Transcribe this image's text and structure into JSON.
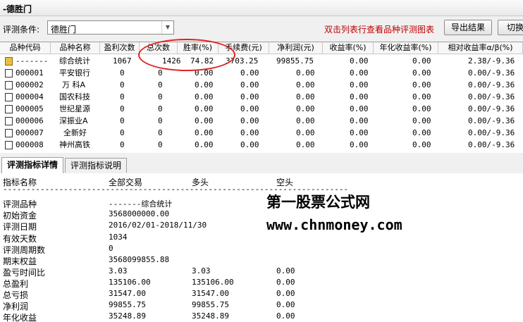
{
  "window": {
    "title": "-德胜门"
  },
  "toolbar": {
    "condition_label": "评测条件:",
    "condition_value": "德胜门",
    "hint": "双击列表行查看品种评测图表",
    "export_label": "导出结果",
    "switch_label": "切换"
  },
  "table": {
    "columns": [
      "品种代码",
      "品种名称",
      "盈利次数",
      "总次数",
      "胜率(%)",
      "手续费(元)",
      "净利润(元)",
      "收益率(%)",
      "年化收益率(%)",
      "相对收益率α/β(%)"
    ],
    "rows": [
      {
        "code": "-------",
        "name": "综合统计",
        "wins": "1067",
        "total": "1426",
        "rate": "74.82",
        "fee": "3703.25",
        "profit": "99855.75",
        "ret": "0.00",
        "annual": "0.00",
        "relative": "2.38/-9.36"
      },
      {
        "code": "000001",
        "name": "平安银行",
        "wins": "0",
        "total": "0",
        "rate": "0.00",
        "fee": "0.00",
        "profit": "0.00",
        "ret": "0.00",
        "annual": "0.00",
        "relative": "0.00/-9.36"
      },
      {
        "code": "000002",
        "name": "万 科A",
        "wins": "0",
        "total": "0",
        "rate": "0.00",
        "fee": "0.00",
        "profit": "0.00",
        "ret": "0.00",
        "annual": "0.00",
        "relative": "0.00/-9.36"
      },
      {
        "code": "000004",
        "name": "国农科技",
        "wins": "0",
        "total": "0",
        "rate": "0.00",
        "fee": "0.00",
        "profit": "0.00",
        "ret": "0.00",
        "annual": "0.00",
        "relative": "0.00/-9.36"
      },
      {
        "code": "000005",
        "name": "世纪星源",
        "wins": "0",
        "total": "0",
        "rate": "0.00",
        "fee": "0.00",
        "profit": "0.00",
        "ret": "0.00",
        "annual": "0.00",
        "relative": "0.00/-9.36"
      },
      {
        "code": "000006",
        "name": "深振业A",
        "wins": "0",
        "total": "0",
        "rate": "0.00",
        "fee": "0.00",
        "profit": "0.00",
        "ret": "0.00",
        "annual": "0.00",
        "relative": "0.00/-9.36"
      },
      {
        "code": "000007",
        "name": "全新好",
        "wins": "0",
        "total": "0",
        "rate": "0.00",
        "fee": "0.00",
        "profit": "0.00",
        "ret": "0.00",
        "annual": "0.00",
        "relative": "0.00/-9.36"
      },
      {
        "code": "000008",
        "name": "神州高铁",
        "wins": "0",
        "total": "0",
        "rate": "0.00",
        "fee": "0.00",
        "profit": "0.00",
        "ret": "0.00",
        "annual": "0.00",
        "relative": "0.00/-9.36"
      }
    ]
  },
  "tabs": [
    {
      "label": "评测指标详情"
    },
    {
      "label": "评测指标说明"
    }
  ],
  "detail": {
    "headers": {
      "name": "指标名称",
      "all": "全部交易",
      "long": "多头",
      "short": "空头"
    },
    "divider": "--------------------------------------------------------------------------",
    "rows": [
      {
        "name": "评测品种",
        "all": "-------综合统计",
        "long": "",
        "short": ""
      },
      {
        "name": "初始资金",
        "all": "3568000000.00",
        "long": "",
        "short": ""
      },
      {
        "name": "评测日期",
        "all": "2016/02/01-2018/11/30",
        "long": "",
        "short": ""
      },
      {
        "name": "有效天数",
        "all": "1034",
        "long": "",
        "short": ""
      },
      {
        "name": "评测周期数",
        "all": "0",
        "long": "",
        "short": ""
      },
      {
        "name": "期末权益",
        "all": "3568099855.88",
        "long": "",
        "short": ""
      },
      {
        "name": "盈亏时间比",
        "all": "3.03",
        "long": "3.03",
        "short": "0.00"
      },
      {
        "name": "总盈利",
        "all": "135106.00",
        "long": "135106.00",
        "short": "0.00"
      },
      {
        "name": "总亏损",
        "all": "31547.00",
        "long": "31547.00",
        "short": "0.00"
      },
      {
        "name": "净利润",
        "all": "99855.75",
        "long": "99855.75",
        "short": "0.00"
      },
      {
        "name": "年化收益",
        "all": "35248.89",
        "long": "35248.89",
        "short": "0.00"
      }
    ]
  },
  "watermark": {
    "line1": "第一股票公式网",
    "line2": "www.chnmoney.com"
  },
  "colors": {
    "hint": "#c00000",
    "annotation_circle": "#e02020"
  }
}
